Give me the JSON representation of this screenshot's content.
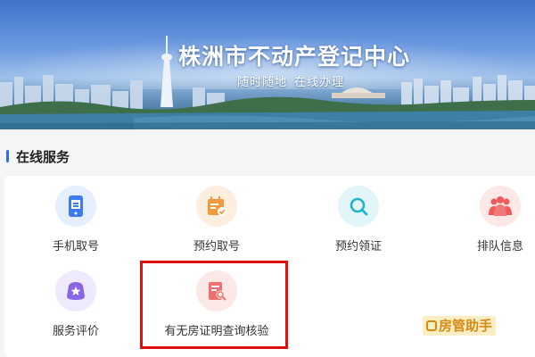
{
  "banner": {
    "title": "株洲市不动产登记中心",
    "subtitle_part1": "随时随地",
    "subtitle_part2": "在线办理"
  },
  "section": {
    "title": "在线服务"
  },
  "services": [
    {
      "label": "手机取号",
      "icon": "phone-ticket-icon",
      "color": "#3d7cf0",
      "bg": "#e6effe"
    },
    {
      "label": "预约取号",
      "icon": "calendar-edit-icon",
      "color": "#f59a3c",
      "bg": "#fdeee0"
    },
    {
      "label": "预约领证",
      "icon": "search-icon",
      "color": "#26b3c9",
      "bg": "#e2f5f8"
    },
    {
      "label": "排队信息",
      "icon": "people-queue-icon",
      "color": "#ef5a5a",
      "bg": "#fde8e8"
    },
    {
      "label": "服务评价",
      "icon": "star-rating-icon",
      "color": "#8a66e6",
      "bg": "#eee9fc"
    },
    {
      "label": "有无房证明查询核验",
      "icon": "document-search-icon",
      "color": "#f07070",
      "bg": "#fde8e8"
    }
  ],
  "colors": {
    "accent": "#2f6ee8",
    "highlight_border": "#e00d0d"
  },
  "watermark": {
    "text": "房管助手"
  }
}
